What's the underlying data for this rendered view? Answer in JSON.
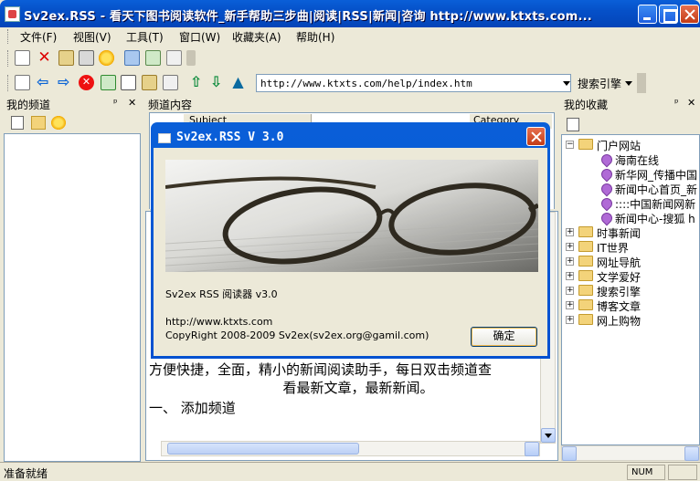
{
  "window": {
    "title": "Sv2ex.RSS - 看天下图书阅读软件_新手帮助三步曲|阅读|RSS|新闻|咨询 http://www.ktxts.com..."
  },
  "menu": [
    "文件(F)",
    "视图(V)",
    "工具(T)",
    "窗口(W)",
    "收藏夹(A)",
    "帮助(H)"
  ],
  "address": {
    "value": "http://www.ktxts.com/help/index.htm",
    "search_engine": "搜索引擎"
  },
  "panes": {
    "left_title": "我的频道",
    "mid_title": "频道内容",
    "mid_col1": "Subject",
    "mid_col2": "Category",
    "right_title": "我的收藏",
    "pin": "ᵖ",
    "close": "✕"
  },
  "favorites": [
    {
      "label": "门户网站",
      "expanded": true,
      "children": [
        "海南在线",
        "新华网_传播中国",
        "新闻中心首页_新",
        "::::中国新闻网新",
        "新闻中心-搜狐 h"
      ]
    },
    {
      "label": "时事新闻"
    },
    {
      "label": "IT世界"
    },
    {
      "label": "网址导航"
    },
    {
      "label": "文学爱好"
    },
    {
      "label": "搜索引擎"
    },
    {
      "label": "博客文章"
    },
    {
      "label": "网上购物"
    }
  ],
  "article": {
    "line1": "方便快捷，全面，精小的新闻阅读助手，每日双击频道查",
    "line2": "看最新文章，最新新闻。",
    "line3": "一、    添加频道"
  },
  "status": {
    "text": "准备就绪",
    "num": "NUM"
  },
  "dialog": {
    "title": "Sv2ex.RSS V 3.0",
    "product": "Sv2ex RSS 阅读器 v3.0",
    "url": "http://www.ktxts.com",
    "copyright": "CopyRight 2008-2009 Sv2ex(sv2ex.org@gamil.com)",
    "ok_label": "确定"
  }
}
